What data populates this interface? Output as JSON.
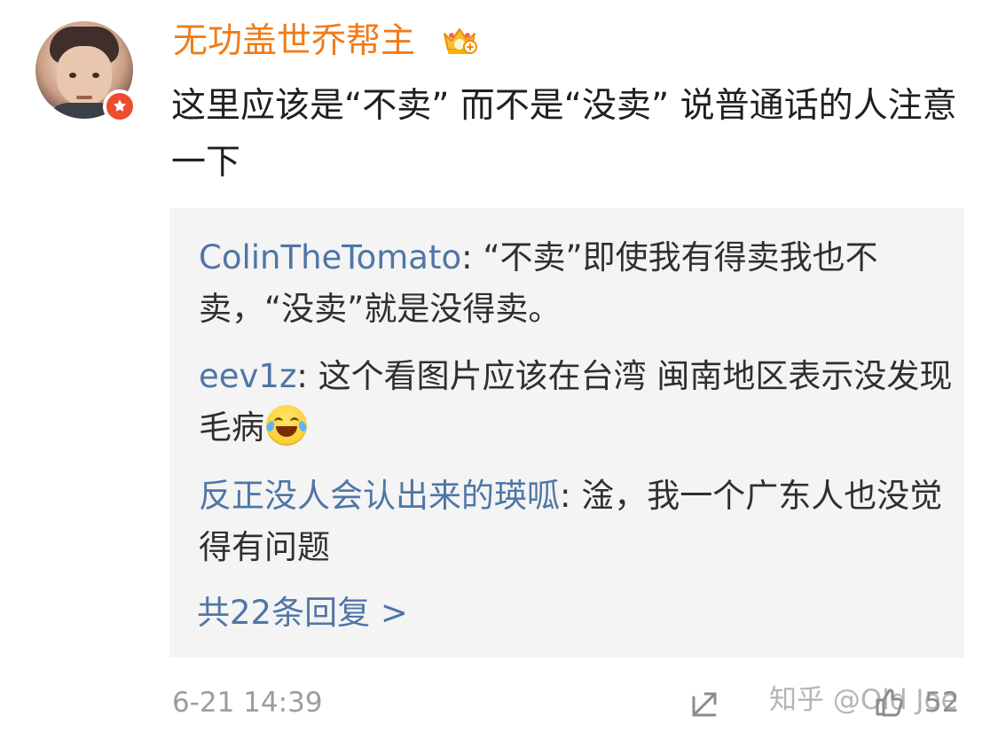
{
  "comment": {
    "username": "无功盖世乔帮主",
    "text": "这里应该是“不卖” 而不是“没卖” 说普通话的人注意一下",
    "timestamp": "6-21 14:39",
    "like_count": "52"
  },
  "replies": [
    {
      "author": "ColinTheTomato",
      "separator": ": ",
      "text": "“不卖”即使我有得卖我也不卖，“没卖”就是没得卖。"
    },
    {
      "author": "eev1z",
      "separator": ": ",
      "text": "这个看图片应该在台湾  闽南地区表示没发现毛病"
    },
    {
      "author": "反正没人会认出来的瑛呱",
      "separator": ": ",
      "text": "淦，我一个广东人也没觉得有问题"
    }
  ],
  "more_replies": "共22条回复 >",
  "watermark": "知乎 @Old Joe",
  "colors": {
    "username": "#f07b1a",
    "reply_author": "#4f76a6",
    "reply_box": "#f4f4f4",
    "badge": "#ef4b2f"
  },
  "icons": {
    "verified_badge": "star-badge-icon",
    "vip_badge": "crown-vip-icon",
    "laugh_emoji": "laugh-cry-emoji-icon",
    "share": "share-icon",
    "like": "thumb-up-icon"
  }
}
